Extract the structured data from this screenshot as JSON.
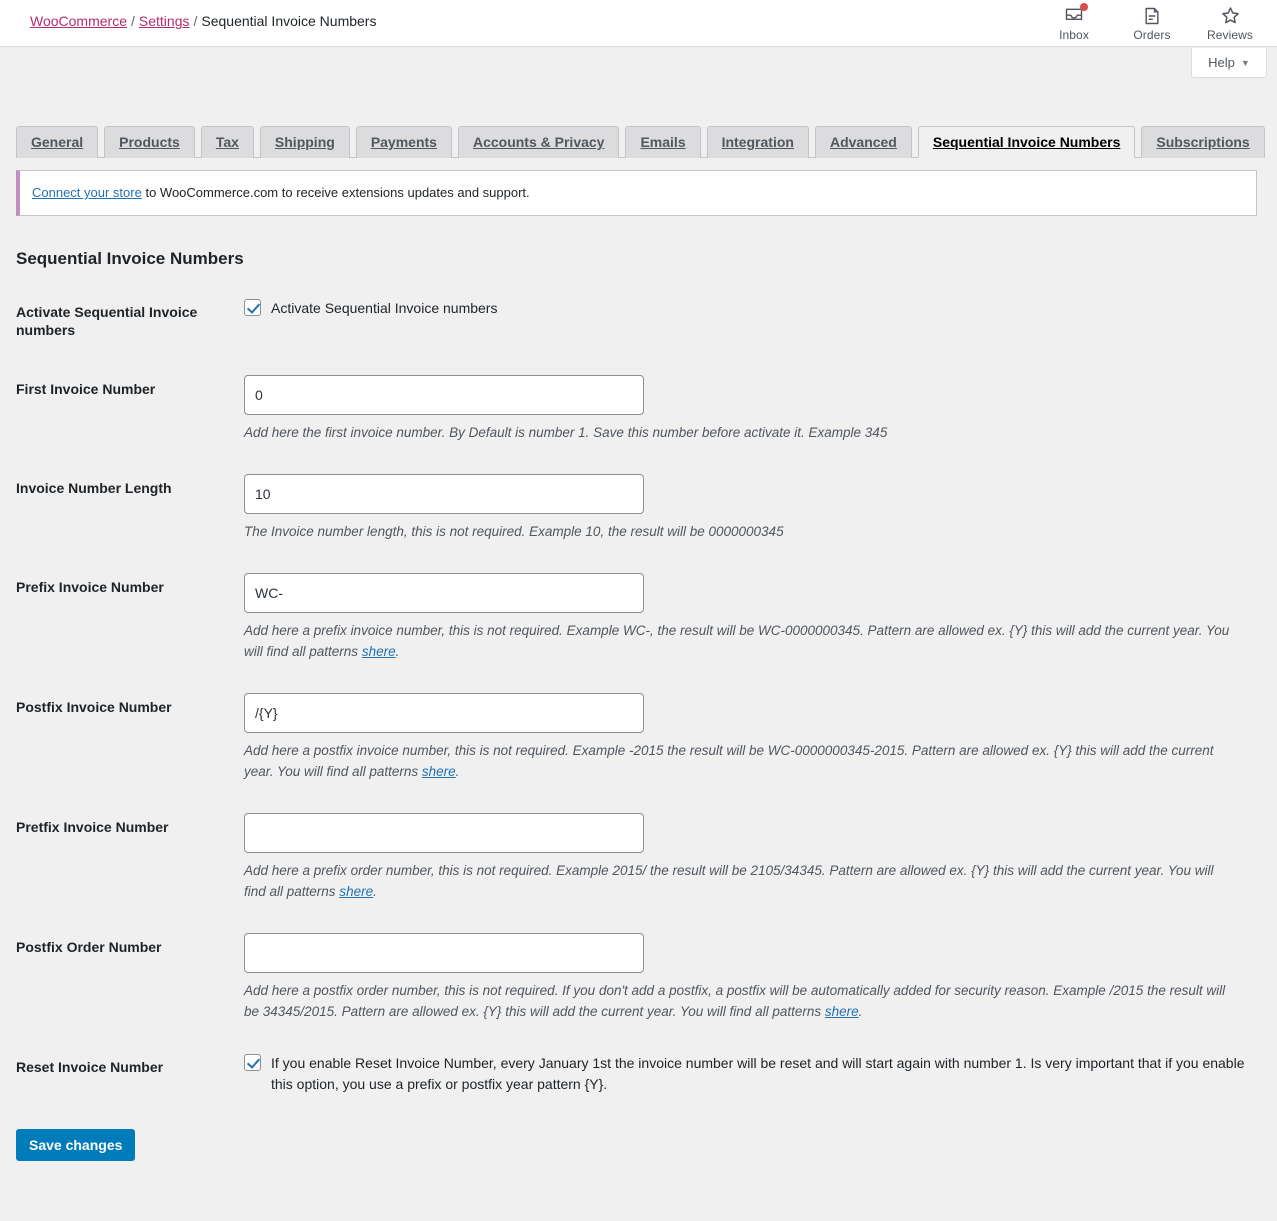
{
  "header": {
    "breadcrumb": {
      "root": "WooCommerce",
      "sep": "/",
      "settings": "Settings",
      "current": "Sequential Invoice Numbers"
    },
    "actions": [
      {
        "label": "Inbox",
        "icon": "inbox-icon",
        "badge": true
      },
      {
        "label": "Orders",
        "icon": "orders-page-icon",
        "badge": false
      },
      {
        "label": "Reviews",
        "icon": "star-icon",
        "badge": false
      }
    ],
    "help_label": "Help",
    "help_caret": "▼"
  },
  "tabs": [
    {
      "label": "General",
      "active": false
    },
    {
      "label": "Products",
      "active": false
    },
    {
      "label": "Tax",
      "active": false
    },
    {
      "label": "Shipping",
      "active": false
    },
    {
      "label": "Payments",
      "active": false
    },
    {
      "label": "Accounts & Privacy",
      "active": false
    },
    {
      "label": "Emails",
      "active": false
    },
    {
      "label": "Integration",
      "active": false
    },
    {
      "label": "Advanced",
      "active": false
    },
    {
      "label": "Sequential Invoice Numbers",
      "active": true
    },
    {
      "label": "Subscriptions",
      "active": false
    }
  ],
  "notice": {
    "link_text": "Connect your store",
    "rest": " to WooCommerce.com to receive extensions updates and support."
  },
  "section": {
    "title": "Sequential Invoice Numbers"
  },
  "settings": {
    "activate": {
      "label": "Activate Sequential Invoice numbers",
      "checkbox_label": "Activate Sequential Invoice numbers",
      "checked": true
    },
    "first_invoice_number": {
      "label": "First Invoice Number",
      "value": "0",
      "description": "Add here the first invoice number. By Default is number 1. Save this number before activate it. Example 345"
    },
    "invoice_number_length": {
      "label": "Invoice Number Length",
      "value": "10",
      "description": "The Invoice number length, this is not required. Example 10, the result will be 0000000345"
    },
    "prefix_invoice_number": {
      "label": "Prefix Invoice Number",
      "value": "WC-",
      "description_before": "Add here a prefix invoice number, this is not required. Example WC-, the result will be WC-0000000345. Pattern are allowed ex. {Y} this will add the current year. You will find all patterns ",
      "link_text": "shere",
      "description_after": "."
    },
    "postfix_invoice_number": {
      "label": "Postfix Invoice Number",
      "value": "/{Y}",
      "description_before": "Add here a postfix invoice number, this is not required. Example -2015 the result will be WC-0000000345-2015. Pattern are allowed ex. {Y} this will add the current year. You will find all patterns ",
      "link_text": "shere",
      "description_after": "."
    },
    "pretfix_invoice_number": {
      "label": "Pretfix Invoice Number",
      "value": "",
      "description_before": "Add here a prefix order number, this is not required. Example 2015/ the result will be 2105/34345. Pattern are allowed ex. {Y} this will add the current year. You will find all patterns ",
      "link_text": "shere",
      "description_after": "."
    },
    "postfix_order_number": {
      "label": "Postfix Order Number",
      "value": "",
      "description_before": "Add here a postfix order number, this is not required. If you don't add a postfix, a postfix will be automatically added for security reason. Example /2015 the result will be 34345/2015. Pattern are allowed ex. {Y} this will add the current year. You will find all patterns ",
      "link_text": "shere",
      "description_after": "."
    },
    "reset_invoice_number": {
      "label": "Reset Invoice Number",
      "checkbox_label": "If you enable Reset Invoice Number, every January 1st the invoice number will be reset and will start again with number 1. Is very important that if you enable this option, you use a prefix or postfix year pattern {Y}.",
      "checked": true
    }
  },
  "submit": {
    "save_label": "Save changes"
  },
  "colors": {
    "accent_link": "#b52b6e",
    "notice_border": "#c28fc2",
    "primary_button": "#007cba",
    "blue_link": "#2271b1",
    "page_bg": "#f0f0f1"
  }
}
